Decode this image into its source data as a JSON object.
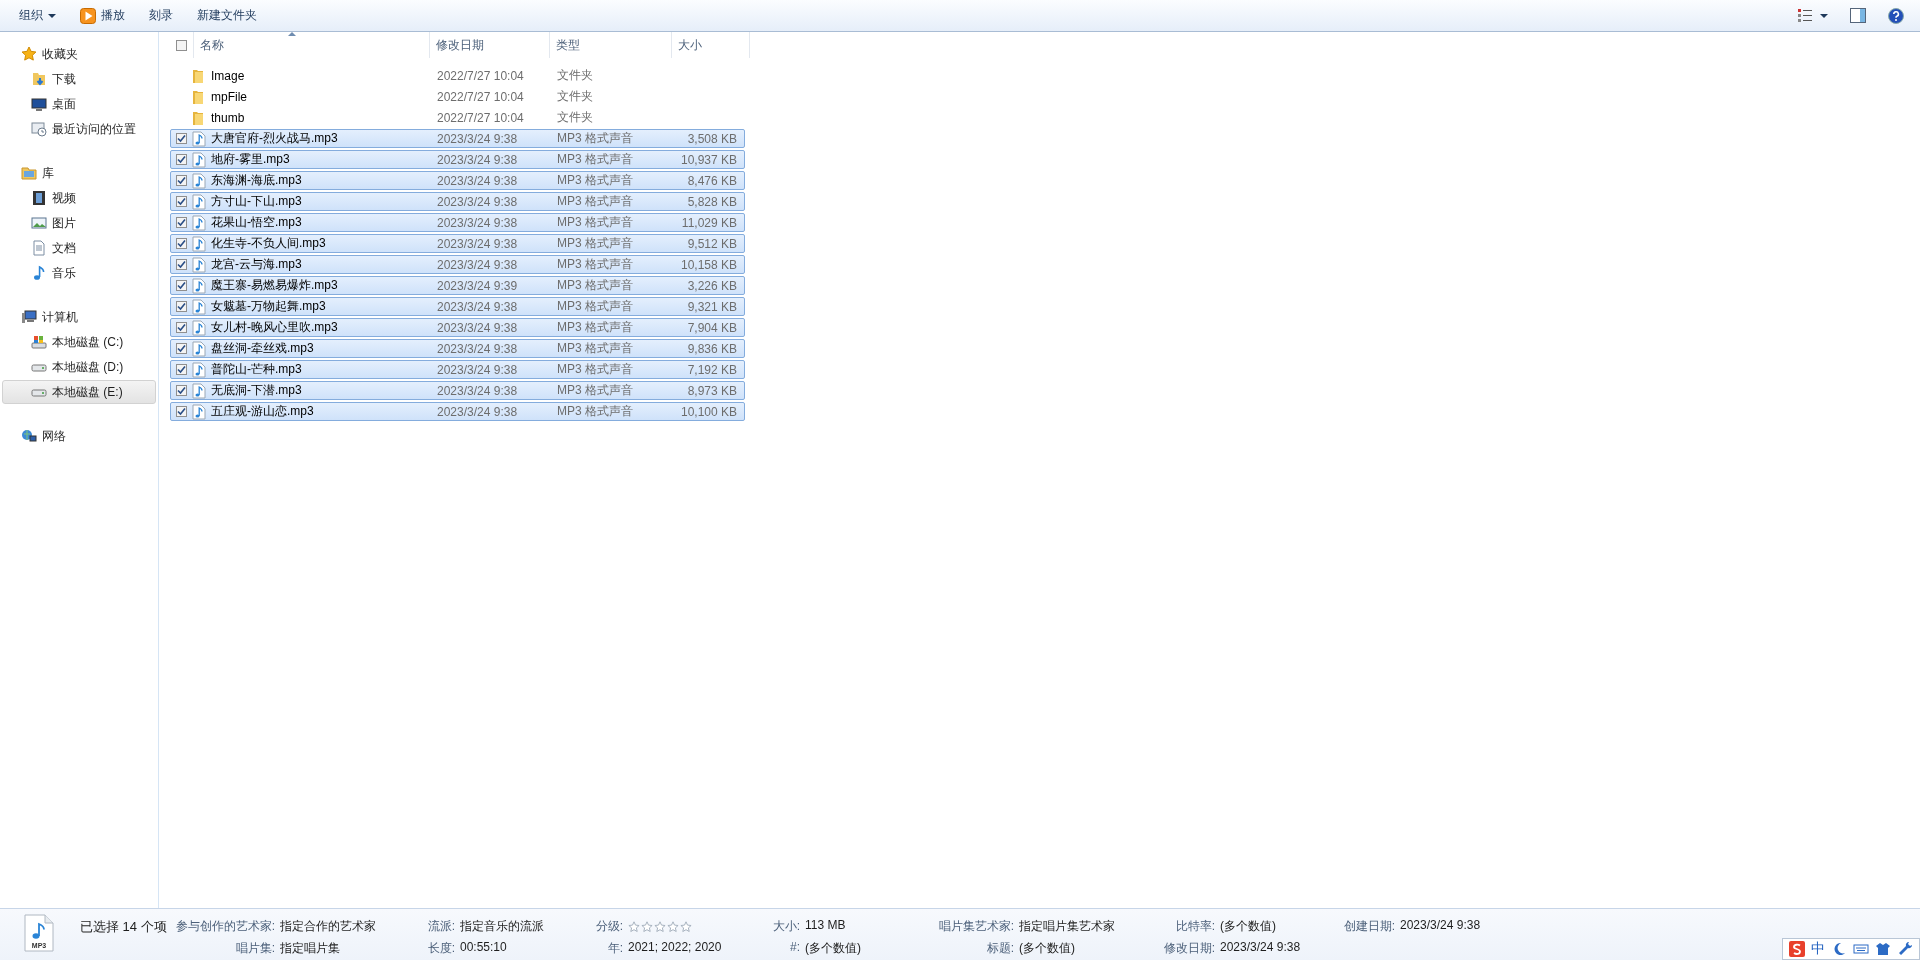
{
  "toolbar": {
    "items": [
      {
        "label": "组织",
        "kind": "menu"
      },
      {
        "label": "播放",
        "kind": "play"
      },
      {
        "label": "刻录",
        "kind": "plain"
      },
      {
        "label": "新建文件夹",
        "kind": "plain"
      }
    ]
  },
  "sidebar": {
    "groups": [
      {
        "label": "收藏夹",
        "selected": false,
        "children": [
          {
            "label": "下载",
            "selected": false
          },
          {
            "label": "桌面",
            "selected": false
          },
          {
            "label": "最近访问的位置",
            "selected": false
          }
        ]
      },
      {
        "label": "库",
        "selected": false,
        "children": [
          {
            "label": "视频",
            "selected": false
          },
          {
            "label": "图片",
            "selected": false
          },
          {
            "label": "文档",
            "selected": false
          },
          {
            "label": "音乐",
            "selected": false
          }
        ]
      },
      {
        "label": "计算机",
        "selected": false,
        "children": [
          {
            "label": "本地磁盘 (C:)",
            "selected": false
          },
          {
            "label": "本地磁盘 (D:)",
            "selected": false
          },
          {
            "label": "本地磁盘 (E:)",
            "selected": true
          }
        ]
      },
      {
        "label": "网络",
        "selected": false
      }
    ]
  },
  "file_list": {
    "select_all": {
      "checked": false
    },
    "columns": [
      {
        "label": "名称",
        "sorted": true
      },
      {
        "label": "修改日期",
        "sorted": false
      },
      {
        "label": "类型",
        "sorted": false
      },
      {
        "label": "大小",
        "sorted": false
      }
    ],
    "rows": [
      {
        "kind": "folder",
        "name": "Image",
        "date": "2022/7/27 10:04",
        "type": "文件夹",
        "selected": false
      },
      {
        "kind": "folder",
        "name": "mpFile",
        "date": "2022/7/27 10:04",
        "type": "文件夹",
        "selected": false
      },
      {
        "kind": "folder",
        "name": "thumb",
        "date": "2022/7/27 10:04",
        "type": "文件夹",
        "selected": false
      },
      {
        "kind": "audio",
        "name": "大唐官府-烈火战马.mp3",
        "date": "2023/3/24 9:38",
        "type": "MP3 格式声音",
        "size": "3,508 KB",
        "selected": true
      },
      {
        "kind": "audio",
        "name": "地府-雾里.mp3",
        "date": "2023/3/24 9:38",
        "type": "MP3 格式声音",
        "size": "10,937 KB",
        "selected": true
      },
      {
        "kind": "audio",
        "name": "东海渊-海底.mp3",
        "date": "2023/3/24 9:38",
        "type": "MP3 格式声音",
        "size": "8,476 KB",
        "selected": true
      },
      {
        "kind": "audio",
        "name": "方寸山-下山.mp3",
        "date": "2023/3/24 9:38",
        "type": "MP3 格式声音",
        "size": "5,828 KB",
        "selected": true
      },
      {
        "kind": "audio",
        "name": "花果山-悟空.mp3",
        "date": "2023/3/24 9:38",
        "type": "MP3 格式声音",
        "size": "11,029 KB",
        "selected": true
      },
      {
        "kind": "audio",
        "name": "化生寺-不负人间.mp3",
        "date": "2023/3/24 9:38",
        "type": "MP3 格式声音",
        "size": "9,512 KB",
        "selected": true
      },
      {
        "kind": "audio",
        "name": "龙宫-云与海.mp3",
        "date": "2023/3/24 9:38",
        "type": "MP3 格式声音",
        "size": "10,158 KB",
        "selected": true
      },
      {
        "kind": "audio",
        "name": "魔王寨-易燃易爆炸.mp3",
        "date": "2023/3/24 9:39",
        "type": "MP3 格式声音",
        "size": "3,226 KB",
        "selected": true
      },
      {
        "kind": "audio",
        "name": "女魃墓-万物起舞.mp3",
        "date": "2023/3/24 9:38",
        "type": "MP3 格式声音",
        "size": "9,321 KB",
        "selected": true
      },
      {
        "kind": "audio",
        "name": "女儿村-晚风心里吹.mp3",
        "date": "2023/3/24 9:38",
        "type": "MP3 格式声音",
        "size": "7,904 KB",
        "selected": true
      },
      {
        "kind": "audio",
        "name": "盘丝洞-牵丝戏.mp3",
        "date": "2023/3/24 9:38",
        "type": "MP3 格式声音",
        "size": "9,836 KB",
        "selected": true
      },
      {
        "kind": "audio",
        "name": "普陀山-芒种.mp3",
        "date": "2023/3/24 9:38",
        "type": "MP3 格式声音",
        "size": "7,192 KB",
        "selected": true
      },
      {
        "kind": "audio",
        "name": "无底洞-下潜.mp3",
        "date": "2023/3/24 9:38",
        "type": "MP3 格式声音",
        "size": "8,973 KB",
        "selected": true
      },
      {
        "kind": "audio",
        "name": "五庄观-游山恋.mp3",
        "date": "2023/3/24 9:38",
        "type": "MP3 格式声音",
        "size": "10,100 KB",
        "selected": true
      }
    ]
  },
  "details_pane": {
    "thumbnail_label": "MP3",
    "summary": "已选择 14 个项",
    "columns": [
      [
        {
          "label": "参与创作的艺术家:",
          "value": "指定合作的艺术家"
        },
        {
          "label": "唱片集:",
          "value": "指定唱片集"
        }
      ],
      [
        {
          "label": "流派:",
          "value": "指定音乐的流派"
        },
        {
          "label": "长度:",
          "value": "00:55:10"
        }
      ],
      [
        {
          "label": "分级:",
          "kind": "stars",
          "stars": 0
        },
        {
          "label": "年:",
          "value": "2021; 2022; 2020"
        }
      ],
      [
        {
          "label": "大小:",
          "value": "113 MB"
        },
        {
          "label": "#:",
          "value": "(多个数值)"
        }
      ],
      [
        {
          "label": "唱片集艺术家:",
          "value": "指定唱片集艺术家"
        },
        {
          "label": "标题:",
          "value": "(多个数值)"
        }
      ],
      [
        {
          "label": "比特率:",
          "value": "(多个数值)"
        },
        {
          "label": "修改日期:",
          "value": "2023/3/24 9:38"
        }
      ],
      [
        {
          "label": "创建日期:",
          "value": "2023/3/24 9:38"
        }
      ]
    ]
  },
  "ime_bar": {
    "label": "中"
  }
}
